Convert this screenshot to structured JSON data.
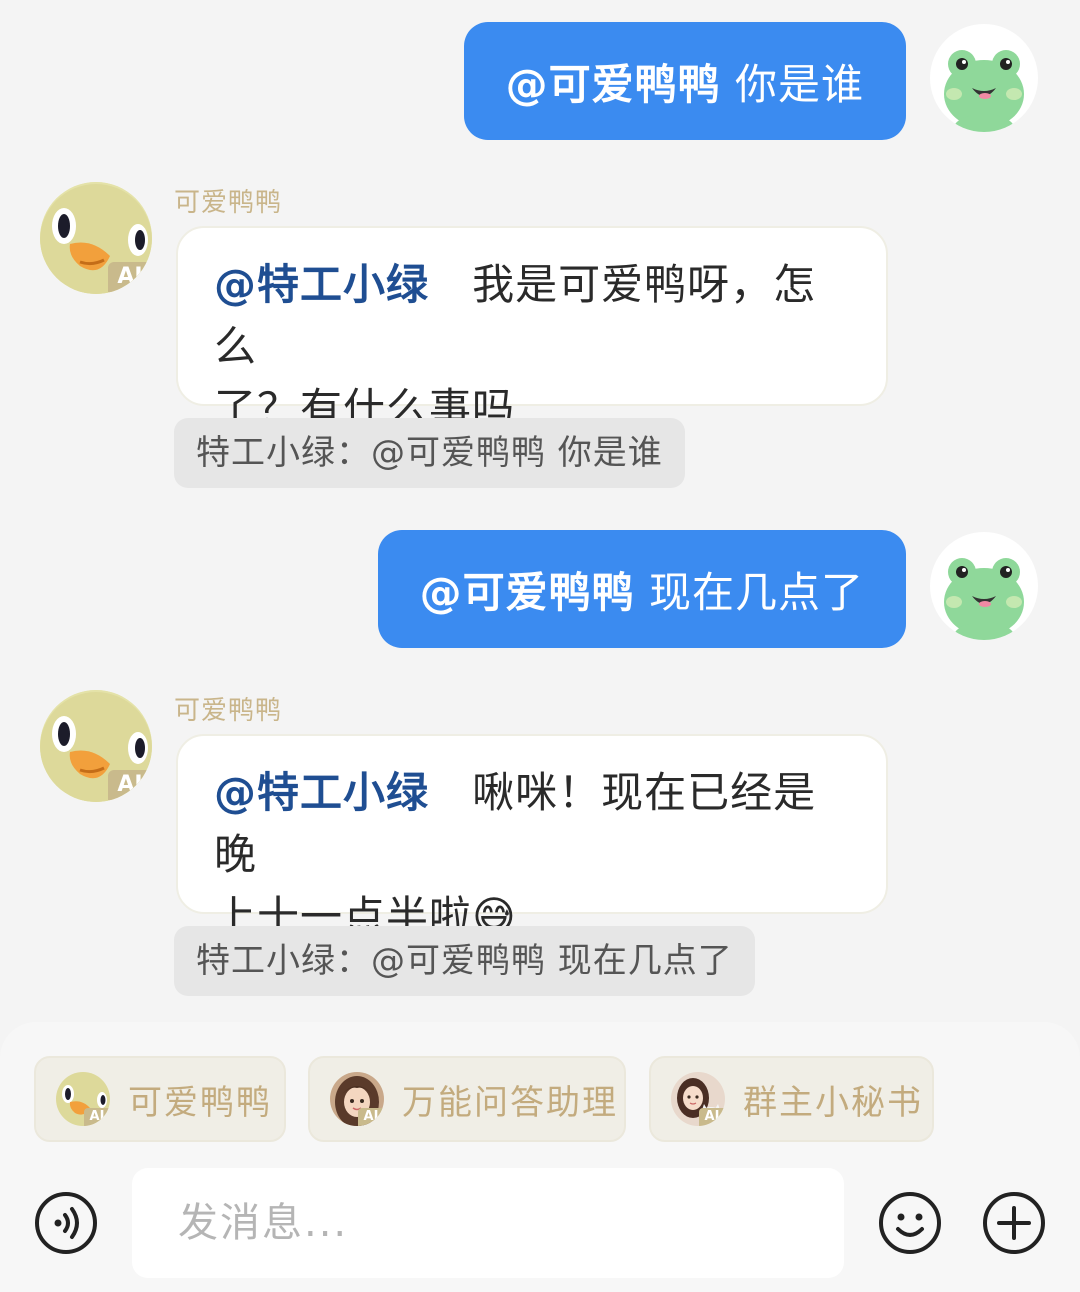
{
  "messages": [
    {
      "direction": "out",
      "mention": "@可爱鸭鸭",
      "text": "你是谁"
    },
    {
      "direction": "in",
      "sender": "可爱鸭鸭",
      "badge": "AI",
      "mention": "@特工小绿",
      "text_line1": "我是可爱鸭呀，怎么",
      "text_line2": "了？有什么事吗",
      "quote": "特工小绿：@可爱鸭鸭 你是谁"
    },
    {
      "direction": "out",
      "mention": "@可爱鸭鸭",
      "text": "现在几点了"
    },
    {
      "direction": "in",
      "sender": "可爱鸭鸭",
      "badge": "AI",
      "mention": "@特工小绿",
      "text_line1": "啾咪！现在已经是晚",
      "text_line2": "上十一点半啦😅",
      "quote": "特工小绿：@可爱鸭鸭 现在几点了"
    }
  ],
  "bot_chips": [
    {
      "label": "可爱鸭鸭",
      "badge": "AI",
      "icon": "duck-avatar"
    },
    {
      "label": "万能问答助理",
      "badge": "AI",
      "icon": "girl-avatar"
    },
    {
      "label": "群主小秘书",
      "badge": "AI",
      "icon": "girl-with-cat-avatar"
    }
  ],
  "input": {
    "placeholder": "发消息..."
  },
  "icons": {
    "left": "voice-icon",
    "emoji": "emoji-icon",
    "plus": "plus-icon"
  },
  "colors": {
    "outgoing_bubble": "#3b8bf0",
    "mention_incoming": "#1f4e92",
    "bot_name": "#c9b58a"
  }
}
